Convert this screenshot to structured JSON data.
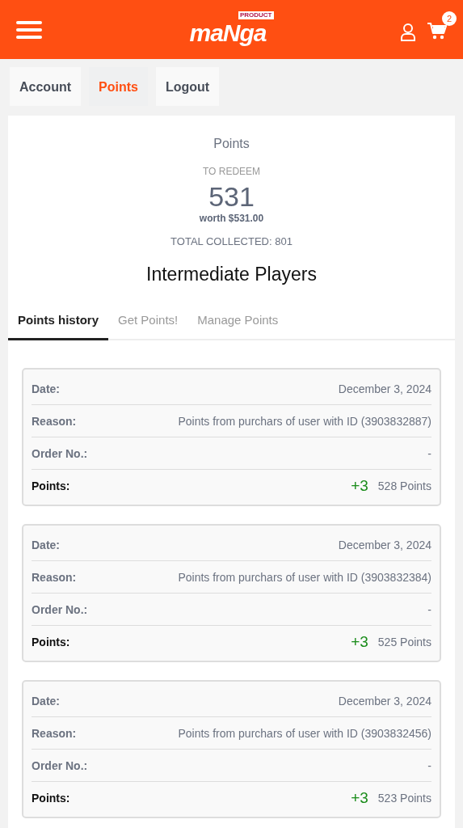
{
  "header": {
    "logo": "maNga",
    "logo_tag": "PRODUCT",
    "cart_count": "2"
  },
  "nav": [
    {
      "label": "Account",
      "selected": false
    },
    {
      "label": "Points",
      "selected": true
    },
    {
      "label": "Logout",
      "selected": false
    }
  ],
  "summary": {
    "title": "Points",
    "redeem_label": "TO REDEEM",
    "redeem_value": "531",
    "worth": "worth $531.00",
    "total_label": "TOTAL COLLECTED:",
    "total_value": "801",
    "level_name": "Intermediate Players"
  },
  "tabs": [
    {
      "label": "Points history",
      "selected": true
    },
    {
      "label": "Get Points!",
      "selected": false
    },
    {
      "label": "Manage Points",
      "selected": false
    }
  ],
  "history": [
    {
      "rows": [
        {
          "kind": "text",
          "label": "Date:",
          "value": "December 3, 2024"
        },
        {
          "kind": "text",
          "label": "Reason:",
          "value": "Points from purchars of user with ID (3903832887)"
        },
        {
          "kind": "text",
          "label": "Order No.:",
          "value": "-"
        },
        {
          "kind": "points",
          "label": "Points:",
          "delta": "+3",
          "value": "528 Points"
        }
      ]
    },
    {
      "rows": [
        {
          "kind": "text",
          "label": "Date:",
          "value": "December 3, 2024"
        },
        {
          "kind": "text",
          "label": "Reason:",
          "value": "Points from purchars of user with ID (3903832384)"
        },
        {
          "kind": "text",
          "label": "Order No.:",
          "value": "-"
        },
        {
          "kind": "points",
          "label": "Points:",
          "delta": "+3",
          "value": "525 Points"
        }
      ]
    },
    {
      "rows": [
        {
          "kind": "text",
          "label": "Date:",
          "value": "December 3, 2024"
        },
        {
          "kind": "text",
          "label": "Reason:",
          "value": "Points from purchars of user with ID (3903832456)"
        },
        {
          "kind": "text",
          "label": "Order No.:",
          "value": "-"
        },
        {
          "kind": "points",
          "label": "Points:",
          "delta": "+3",
          "value": "523 Points"
        }
      ]
    }
  ]
}
